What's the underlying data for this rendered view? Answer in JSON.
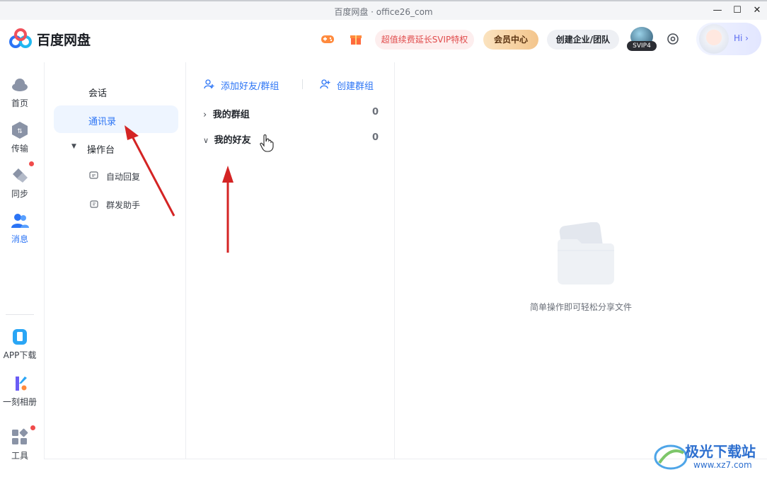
{
  "window": {
    "title": "百度网盘 · office26_com",
    "minimize": "—",
    "maximize": "☐",
    "close": "✕"
  },
  "header": {
    "brand": "百度网盘",
    "promo": "超值续费延长SVIP特权",
    "vip_center": "会员中心",
    "enterprise": "创建企业/团队",
    "svip_badge": "SVIP4",
    "hi": "Hi ›"
  },
  "nav": {
    "items": [
      {
        "label": "首页",
        "icon": "cloud-icon"
      },
      {
        "label": "传输",
        "icon": "transfer-icon"
      },
      {
        "label": "同步",
        "icon": "sync-icon"
      },
      {
        "label": "消息",
        "icon": "message-icon"
      },
      {
        "label": "APP下载",
        "icon": "phone-icon"
      },
      {
        "label": "一刻相册",
        "icon": "album-icon"
      },
      {
        "label": "工具",
        "icon": "tools-icon"
      }
    ]
  },
  "sidebar": {
    "chat": "会话",
    "contacts": "通讯录",
    "workbench": "操作台",
    "auto_reply": "自动回复",
    "group_send": "群发助手"
  },
  "contacts": {
    "add_friend": "添加好友/群组",
    "create_group": "创建群组",
    "groups": {
      "label": "我的群组",
      "count": "0"
    },
    "friends": {
      "label": "我的好友",
      "count": "0"
    }
  },
  "empty_state": {
    "text": "简单操作即可轻松分享文件"
  },
  "watermark": {
    "name": "极光下载站",
    "url": "www.xz7.com"
  },
  "colors": {
    "accent": "#2b74f5",
    "annotation": "#d42424"
  }
}
